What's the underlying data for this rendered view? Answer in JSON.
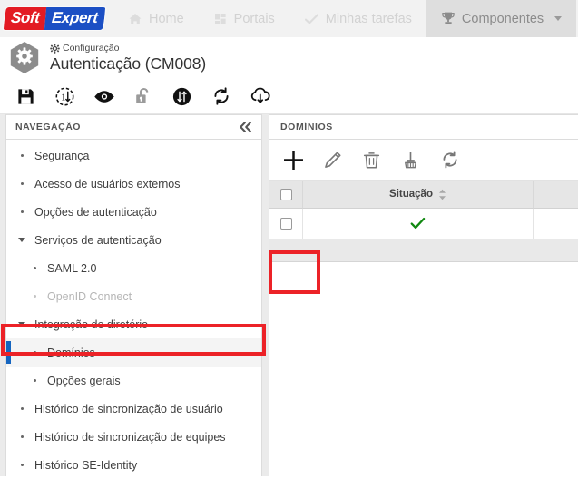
{
  "header": {
    "logo": {
      "part1": "Soft",
      "part2": "Expert"
    },
    "tabs": [
      {
        "label": "Home",
        "icon": "home-icon",
        "active": false,
        "caret": false
      },
      {
        "label": "Portais",
        "icon": "grid-icon",
        "active": false,
        "caret": false
      },
      {
        "label": "Minhas tarefas",
        "icon": "check-icon",
        "active": false,
        "caret": false
      },
      {
        "label": "Componentes",
        "icon": "trophy-icon",
        "active": true,
        "caret": true
      }
    ]
  },
  "page": {
    "kicker": "Configuração",
    "title": "Autenticação (CM008)",
    "icon": "gear-hexagon-icon"
  },
  "toolbar": {
    "buttons": [
      {
        "name": "save-button",
        "icon": "floppy-disk-icon",
        "enabled": true
      },
      {
        "name": "revision-button",
        "icon": "circle-one-arrow-dashed-icon",
        "enabled": true
      },
      {
        "name": "view-button",
        "icon": "eye-icon",
        "enabled": true
      },
      {
        "name": "unlock-button",
        "icon": "open-padlock-icon",
        "enabled": false
      },
      {
        "name": "transfer-button",
        "icon": "circle-arrows-filled-icon",
        "enabled": true
      },
      {
        "name": "sync-button",
        "icon": "refresh-icon",
        "enabled": true
      },
      {
        "name": "cloud-download-button",
        "icon": "cloud-download-icon",
        "enabled": true
      }
    ]
  },
  "navigation": {
    "title": "NAVEGAÇÃO",
    "collapse_icon": "chevron-double-left-icon",
    "items": [
      {
        "label": "Segurança",
        "type": "dot",
        "indent": false,
        "state": "normal"
      },
      {
        "label": "Acesso de usuários externos",
        "type": "dot",
        "indent": false,
        "state": "normal"
      },
      {
        "label": "Opções de autenticação",
        "type": "dot",
        "indent": false,
        "state": "normal"
      },
      {
        "label": "Serviços de autenticação",
        "type": "triangle",
        "indent": false,
        "state": "normal"
      },
      {
        "label": "SAML 2.0",
        "type": "dot",
        "indent": true,
        "state": "normal"
      },
      {
        "label": "OpenID Connect",
        "type": "dot",
        "indent": true,
        "state": "disabled"
      },
      {
        "label": "Integração de diretório",
        "type": "triangle",
        "indent": false,
        "state": "normal"
      },
      {
        "label": "Domínios",
        "type": "dot",
        "indent": true,
        "state": "selected"
      },
      {
        "label": "Opções gerais",
        "type": "dot",
        "indent": true,
        "state": "normal"
      },
      {
        "label": "Histórico de sincronização de usuário",
        "type": "dot",
        "indent": false,
        "state": "normal"
      },
      {
        "label": "Histórico de sincronização de equipes",
        "type": "dot",
        "indent": false,
        "state": "normal"
      },
      {
        "label": "Histórico SE-Identity",
        "type": "dot",
        "indent": false,
        "state": "normal"
      }
    ]
  },
  "domains": {
    "title": "DOMÍNIOS",
    "toolbar": [
      {
        "name": "add-button",
        "icon": "plus-icon",
        "highlighted": true
      },
      {
        "name": "edit-button",
        "icon": "pencil-icon",
        "highlighted": false
      },
      {
        "name": "delete-button",
        "icon": "trash-icon",
        "highlighted": false
      },
      {
        "name": "clear-button",
        "icon": "broom-icon",
        "highlighted": false
      },
      {
        "name": "refresh-button",
        "icon": "refresh-icon",
        "highlighted": false
      }
    ],
    "table": {
      "columns": [
        "",
        "Situação",
        ""
      ],
      "sortable_column": "Situação",
      "rows": [
        {
          "checked": false,
          "situacao": "active-check",
          "extra": ""
        }
      ]
    }
  },
  "annotations": [
    {
      "name": "annotation-domains-item",
      "color": "#ec2227",
      "target": "Domínios"
    },
    {
      "name": "annotation-add-button",
      "color": "#ec2227",
      "target": "add-button"
    }
  ]
}
